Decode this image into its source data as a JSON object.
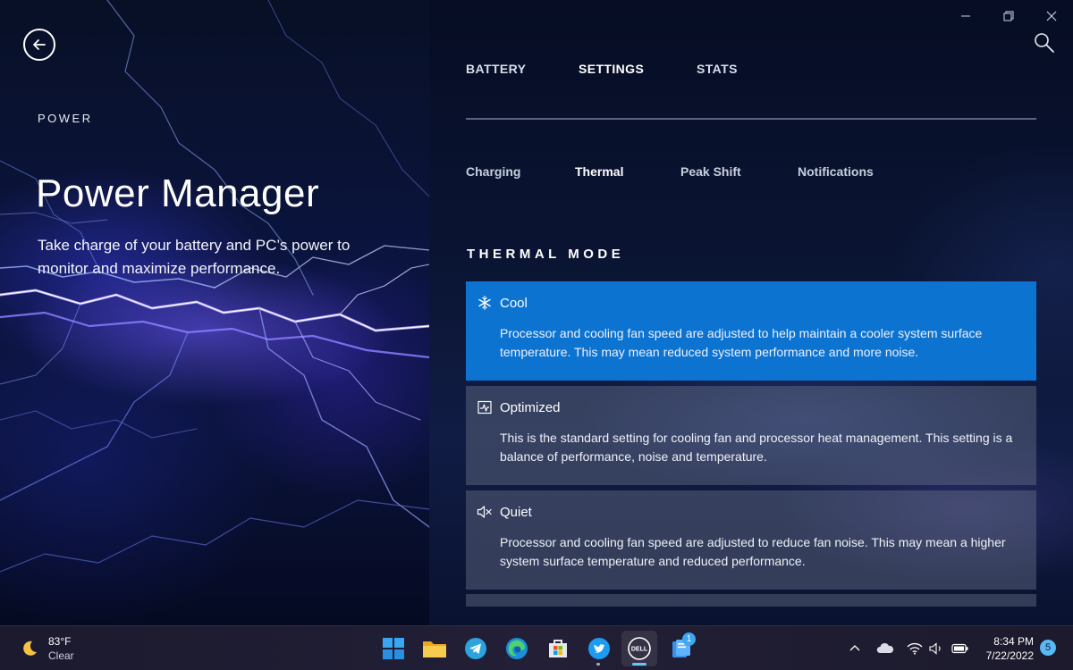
{
  "hero": {
    "eyebrow": "POWER",
    "title": "Power Manager",
    "description": "Take charge of your battery and PC’s power to monitor and maximize performance."
  },
  "main_tabs": [
    {
      "label": "BATTERY",
      "active": false
    },
    {
      "label": "SETTINGS",
      "active": true
    },
    {
      "label": "STATS",
      "active": false
    }
  ],
  "sub_tabs": [
    {
      "label": "Charging",
      "active": false
    },
    {
      "label": "Thermal",
      "active": true
    },
    {
      "label": "Peak Shift",
      "active": false
    },
    {
      "label": "Notifications",
      "active": false
    }
  ],
  "thermal": {
    "section_title": "THERMAL MODE",
    "modes": [
      {
        "name": "Cool",
        "icon": "snowflake-icon",
        "selected": true,
        "description": "Processor and cooling fan speed are adjusted to help maintain a cooler system surface temperature. This may mean reduced system performance and more noise."
      },
      {
        "name": "Optimized",
        "icon": "pulse-chart-icon",
        "selected": false,
        "description": "This is the standard setting for cooling fan and processor heat management. This setting is a balance of performance, noise and temperature."
      },
      {
        "name": "Quiet",
        "icon": "speaker-mute-icon",
        "selected": false,
        "description": "Processor and cooling fan speed are adjusted to reduce fan noise. This may mean a higher system surface temperature and reduced performance."
      }
    ]
  },
  "taskbar": {
    "weather": {
      "temp": "83°F",
      "condition": "Clear"
    },
    "apps": [
      "windows-start",
      "file-explorer",
      "telegram",
      "edge",
      "microsoft-store",
      "twitter",
      "dell",
      "task-manager"
    ],
    "badge_count": "1",
    "clock": {
      "time": "8:34 PM",
      "date": "7/22/2022"
    },
    "notifications_count": "5"
  },
  "colors": {
    "accent": "#0c73d1",
    "card": "#5d6580",
    "taskbar_indicator": "#6cc3ff"
  }
}
